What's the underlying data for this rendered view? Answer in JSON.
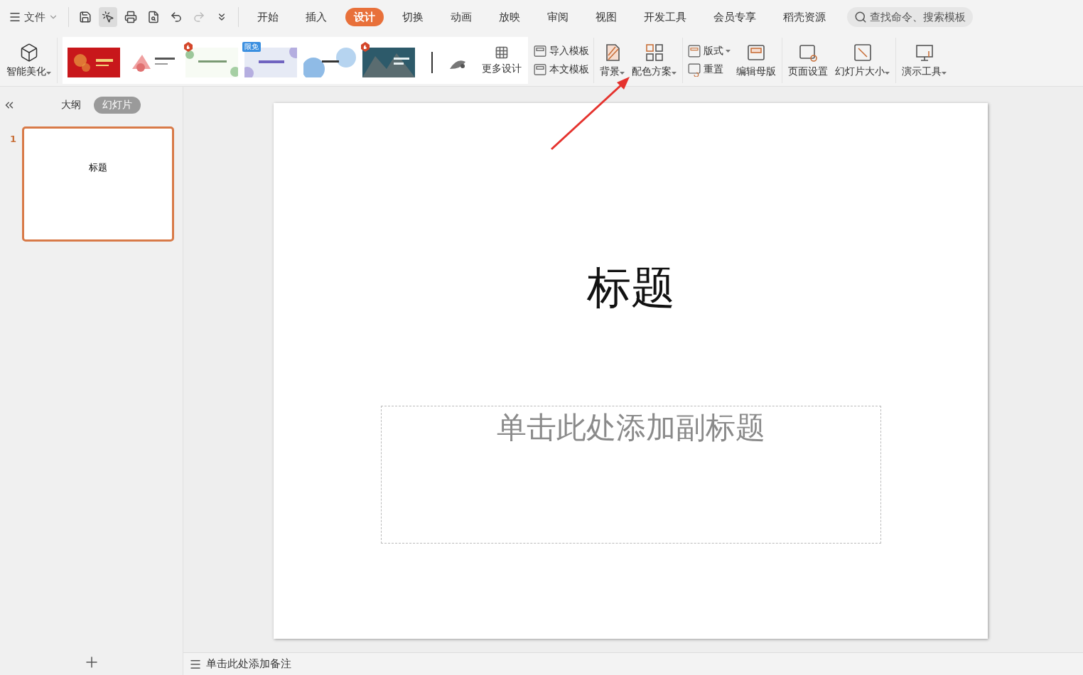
{
  "file_menu": {
    "label": "文件"
  },
  "tabs": [
    {
      "label": "开始",
      "selected": false
    },
    {
      "label": "插入",
      "selected": false
    },
    {
      "label": "设计",
      "selected": true
    },
    {
      "label": "切换",
      "selected": false
    },
    {
      "label": "动画",
      "selected": false
    },
    {
      "label": "放映",
      "selected": false
    },
    {
      "label": "审阅",
      "selected": false
    },
    {
      "label": "视图",
      "selected": false
    },
    {
      "label": "开发工具",
      "selected": false
    },
    {
      "label": "会员专享",
      "selected": false
    },
    {
      "label": "稻壳资源",
      "selected": false
    }
  ],
  "search": {
    "placeholder": "查找命令、搜索模板"
  },
  "ribbon": {
    "smart_beautify": {
      "label": "智能美化",
      "dropdown": true
    },
    "templates": [
      {
        "kind": "picture"
      },
      {
        "kind": "picture"
      },
      {
        "kind": "picture",
        "badge": {
          "kind": "icon"
        }
      },
      {
        "kind": "picture",
        "badge": {
          "kind": "text",
          "text": "限免"
        }
      },
      {
        "kind": "picture"
      },
      {
        "kind": "picture",
        "badge": {
          "kind": "icon"
        }
      },
      {
        "kind": "picture"
      }
    ],
    "more_designs": "更多设计",
    "template_buttons": [
      {
        "label": "导入模板"
      },
      {
        "label": "本文模板"
      }
    ],
    "background": {
      "label": "背景",
      "dropdown": true
    },
    "color_scheme": {
      "label": "配色方案",
      "dropdown": true
    },
    "layout": {
      "label": "版式",
      "dropdown": true
    },
    "reset": {
      "label": "重置"
    },
    "edit_master": {
      "label": "编辑母版"
    },
    "page_setup": {
      "label": "页面设置"
    },
    "slide_size": {
      "label": "幻灯片大小",
      "dropdown": true
    },
    "present_tools": {
      "label": "演示工具",
      "dropdown": true
    }
  },
  "panel": {
    "view_tabs": [
      {
        "label": "大纲",
        "selected": false
      },
      {
        "label": "幻灯片",
        "selected": true
      }
    ],
    "slides": [
      {
        "number": "1",
        "title": "标题",
        "selected": true
      }
    ]
  },
  "slide": {
    "title": "标题",
    "subtitle_placeholder": "单击此处添加副标题"
  },
  "notes": {
    "placeholder": "单击此处添加备注"
  }
}
